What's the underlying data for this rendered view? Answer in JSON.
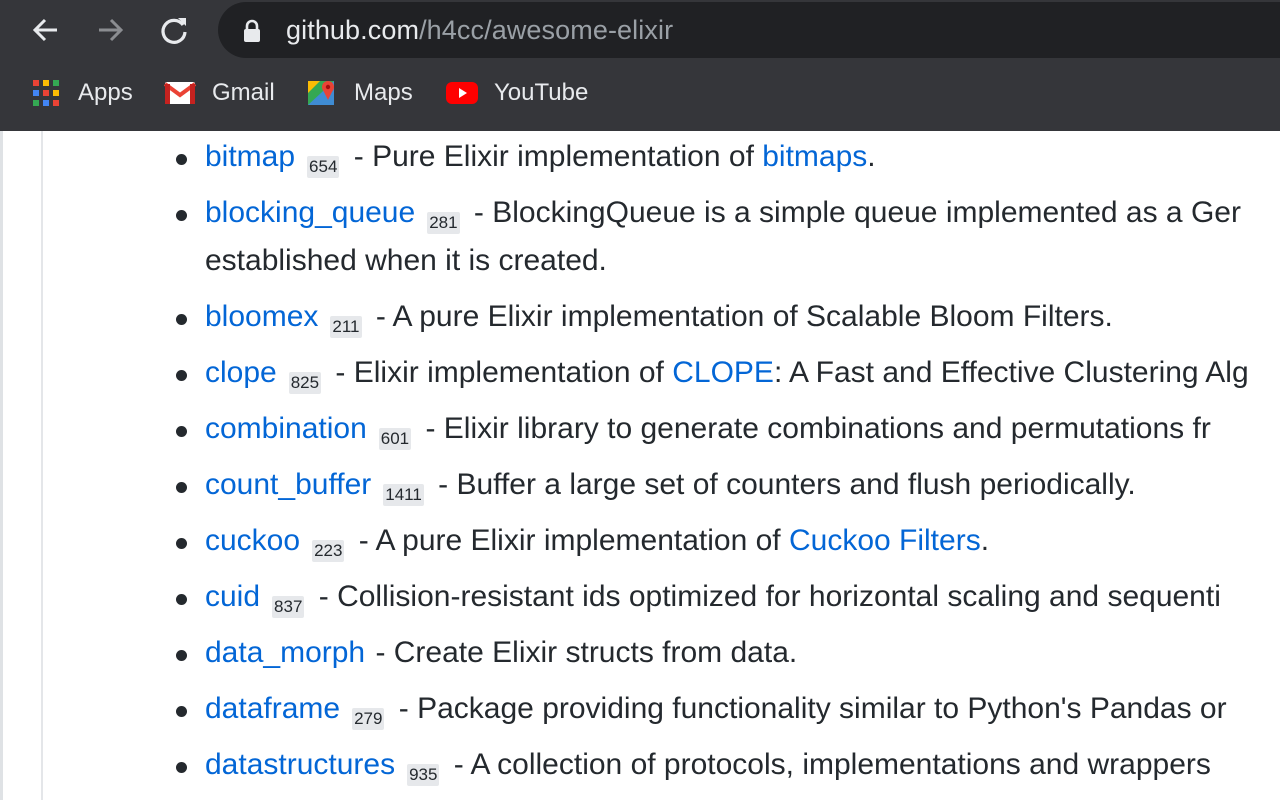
{
  "browser": {
    "url_host": "github.com",
    "url_path": "/h4cc/awesome-elixir",
    "bookmarks": [
      {
        "label": "Apps",
        "icon": "apps-grid-icon"
      },
      {
        "label": "Gmail",
        "icon": "gmail-icon"
      },
      {
        "label": "Maps",
        "icon": "maps-icon"
      },
      {
        "label": "YouTube",
        "icon": "youtube-icon"
      }
    ],
    "colors": {
      "toolbar": "#35363a",
      "omnibox": "#202124",
      "link": "#0366d6"
    }
  },
  "items": [
    {
      "name": "bitmap",
      "stars": "654",
      "desc_pre": " - Pure Elixir implementation of ",
      "link": "bitmaps",
      "desc_post": "."
    },
    {
      "name": "blocking_queue",
      "stars": "281",
      "desc_pre": " - BlockingQueue is a simple queue implemented as a Ger",
      "link": "",
      "desc_post": "",
      "desc_cont": "established when it is created."
    },
    {
      "name": "bloomex",
      "stars": "211",
      "desc_pre": " - A pure Elixir implementation of Scalable Bloom Filters.",
      "link": "",
      "desc_post": ""
    },
    {
      "name": "clope",
      "stars": "825",
      "desc_pre": " - Elixir implementation of ",
      "link": "CLOPE",
      "desc_post": ": A Fast and Effective Clustering Alg"
    },
    {
      "name": "combination",
      "stars": "601",
      "desc_pre": " - Elixir library to generate combinations and permutations fr",
      "link": "",
      "desc_post": ""
    },
    {
      "name": "count_buffer",
      "stars": "1411",
      "desc_pre": " - Buffer a large set of counters and flush periodically.",
      "link": "",
      "desc_post": ""
    },
    {
      "name": "cuckoo",
      "stars": "223",
      "desc_pre": " - A pure Elixir implementation of ",
      "link": "Cuckoo Filters",
      "desc_post": "."
    },
    {
      "name": "cuid",
      "stars": "837",
      "desc_pre": " - Collision-resistant ids optimized for horizontal scaling and sequenti",
      "link": "",
      "desc_post": ""
    },
    {
      "name": "data_morph",
      "stars": "",
      "desc_pre": " - Create Elixir structs from data.",
      "link": "",
      "desc_post": ""
    },
    {
      "name": "dataframe",
      "stars": "279",
      "desc_pre": " - Package providing functionality similar to Python's Pandas or",
      "link": "",
      "desc_post": ""
    },
    {
      "name": "datastructures",
      "stars": "935",
      "desc_pre": " - A collection of protocols, implementations and wrappers",
      "link": "",
      "desc_post": ""
    }
  ]
}
